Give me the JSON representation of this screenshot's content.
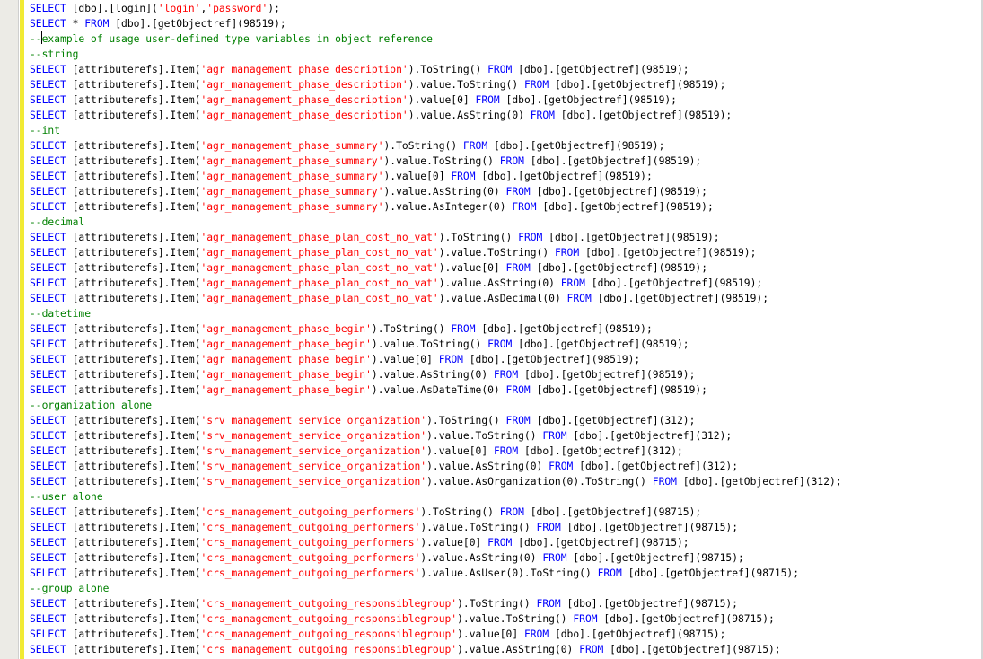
{
  "colors": {
    "keyword": "#0000ff",
    "string": "#ff0000",
    "comment": "#008000",
    "text": "#000000",
    "change_bar": "#f1ea33"
  },
  "lines": [
    [
      [
        "k",
        "SELECT"
      ],
      [
        "t",
        " [dbo].[login]("
      ],
      [
        "s",
        "'login'"
      ],
      [
        "t",
        ","
      ],
      [
        "s",
        "'password'"
      ],
      [
        "t",
        ");"
      ]
    ],
    [
      [
        "k",
        "SELECT"
      ],
      [
        "t",
        " * "
      ],
      [
        "k",
        "FROM"
      ],
      [
        "t",
        " [dbo].[getObjectref](98519);"
      ]
    ],
    [
      [
        "c",
        "--example of usage user-defined type variables in object reference"
      ]
    ],
    [
      [
        "c",
        "--string"
      ]
    ],
    [
      [
        "k",
        "SELECT"
      ],
      [
        "t",
        " [attributerefs].Item("
      ],
      [
        "s",
        "'agr_management_phase_description'"
      ],
      [
        "t",
        ").ToString() "
      ],
      [
        "k",
        "FROM"
      ],
      [
        "t",
        " [dbo].[getObjectref](98519);"
      ]
    ],
    [
      [
        "k",
        "SELECT"
      ],
      [
        "t",
        " [attributerefs].Item("
      ],
      [
        "s",
        "'agr_management_phase_description'"
      ],
      [
        "t",
        ").value.ToString() "
      ],
      [
        "k",
        "FROM"
      ],
      [
        "t",
        " [dbo].[getObjectref](98519);"
      ]
    ],
    [
      [
        "k",
        "SELECT"
      ],
      [
        "t",
        " [attributerefs].Item("
      ],
      [
        "s",
        "'agr_management_phase_description'"
      ],
      [
        "t",
        ").value[0] "
      ],
      [
        "k",
        "FROM"
      ],
      [
        "t",
        " [dbo].[getObjectref](98519);"
      ]
    ],
    [
      [
        "k",
        "SELECT"
      ],
      [
        "t",
        " [attributerefs].Item("
      ],
      [
        "s",
        "'agr_management_phase_description'"
      ],
      [
        "t",
        ").value.AsString(0) "
      ],
      [
        "k",
        "FROM"
      ],
      [
        "t",
        " [dbo].[getObjectref](98519);"
      ]
    ],
    [
      [
        "c",
        "--int"
      ]
    ],
    [
      [
        "k",
        "SELECT"
      ],
      [
        "t",
        " [attributerefs].Item("
      ],
      [
        "s",
        "'agr_management_phase_summary'"
      ],
      [
        "t",
        ").ToString() "
      ],
      [
        "k",
        "FROM"
      ],
      [
        "t",
        " [dbo].[getObjectref](98519);"
      ]
    ],
    [
      [
        "k",
        "SELECT"
      ],
      [
        "t",
        " [attributerefs].Item("
      ],
      [
        "s",
        "'agr_management_phase_summary'"
      ],
      [
        "t",
        ").value.ToString() "
      ],
      [
        "k",
        "FROM"
      ],
      [
        "t",
        " [dbo].[getObjectref](98519);"
      ]
    ],
    [
      [
        "k",
        "SELECT"
      ],
      [
        "t",
        " [attributerefs].Item("
      ],
      [
        "s",
        "'agr_management_phase_summary'"
      ],
      [
        "t",
        ").value[0] "
      ],
      [
        "k",
        "FROM"
      ],
      [
        "t",
        " [dbo].[getObjectref](98519);"
      ]
    ],
    [
      [
        "k",
        "SELECT"
      ],
      [
        "t",
        " [attributerefs].Item("
      ],
      [
        "s",
        "'agr_management_phase_summary'"
      ],
      [
        "t",
        ").value.AsString(0) "
      ],
      [
        "k",
        "FROM"
      ],
      [
        "t",
        " [dbo].[getObjectref](98519);"
      ]
    ],
    [
      [
        "k",
        "SELECT"
      ],
      [
        "t",
        " [attributerefs].Item("
      ],
      [
        "s",
        "'agr_management_phase_summary'"
      ],
      [
        "t",
        ").value.AsInteger(0) "
      ],
      [
        "k",
        "FROM"
      ],
      [
        "t",
        " [dbo].[getObjectref](98519);"
      ]
    ],
    [
      [
        "c",
        "--decimal"
      ]
    ],
    [
      [
        "k",
        "SELECT"
      ],
      [
        "t",
        " [attributerefs].Item("
      ],
      [
        "s",
        "'agr_management_phase_plan_cost_no_vat'"
      ],
      [
        "t",
        ").ToString() "
      ],
      [
        "k",
        "FROM"
      ],
      [
        "t",
        " [dbo].[getObjectref](98519);"
      ]
    ],
    [
      [
        "k",
        "SELECT"
      ],
      [
        "t",
        " [attributerefs].Item("
      ],
      [
        "s",
        "'agr_management_phase_plan_cost_no_vat'"
      ],
      [
        "t",
        ").value.ToString() "
      ],
      [
        "k",
        "FROM"
      ],
      [
        "t",
        " [dbo].[getObjectref](98519);"
      ]
    ],
    [
      [
        "k",
        "SELECT"
      ],
      [
        "t",
        " [attributerefs].Item("
      ],
      [
        "s",
        "'agr_management_phase_plan_cost_no_vat'"
      ],
      [
        "t",
        ").value[0] "
      ],
      [
        "k",
        "FROM"
      ],
      [
        "t",
        " [dbo].[getObjectref](98519);"
      ]
    ],
    [
      [
        "k",
        "SELECT"
      ],
      [
        "t",
        " [attributerefs].Item("
      ],
      [
        "s",
        "'agr_management_phase_plan_cost_no_vat'"
      ],
      [
        "t",
        ").value.AsString(0) "
      ],
      [
        "k",
        "FROM"
      ],
      [
        "t",
        " [dbo].[getObjectref](98519);"
      ]
    ],
    [
      [
        "k",
        "SELECT"
      ],
      [
        "t",
        " [attributerefs].Item("
      ],
      [
        "s",
        "'agr_management_phase_plan_cost_no_vat'"
      ],
      [
        "t",
        ").value.AsDecimal(0) "
      ],
      [
        "k",
        "FROM"
      ],
      [
        "t",
        " [dbo].[getObjectref](98519);"
      ]
    ],
    [
      [
        "c",
        "--datetime"
      ]
    ],
    [
      [
        "k",
        "SELECT"
      ],
      [
        "t",
        " [attributerefs].Item("
      ],
      [
        "s",
        "'agr_management_phase_begin'"
      ],
      [
        "t",
        ").ToString() "
      ],
      [
        "k",
        "FROM"
      ],
      [
        "t",
        " [dbo].[getObjectref](98519);"
      ]
    ],
    [
      [
        "k",
        "SELECT"
      ],
      [
        "t",
        " [attributerefs].Item("
      ],
      [
        "s",
        "'agr_management_phase_begin'"
      ],
      [
        "t",
        ").value.ToString() "
      ],
      [
        "k",
        "FROM"
      ],
      [
        "t",
        " [dbo].[getObjectref](98519);"
      ]
    ],
    [
      [
        "k",
        "SELECT"
      ],
      [
        "t",
        " [attributerefs].Item("
      ],
      [
        "s",
        "'agr_management_phase_begin'"
      ],
      [
        "t",
        ").value[0] "
      ],
      [
        "k",
        "FROM"
      ],
      [
        "t",
        " [dbo].[getObjectref](98519);"
      ]
    ],
    [
      [
        "k",
        "SELECT"
      ],
      [
        "t",
        " [attributerefs].Item("
      ],
      [
        "s",
        "'agr_management_phase_begin'"
      ],
      [
        "t",
        ").value.AsString(0) "
      ],
      [
        "k",
        "FROM"
      ],
      [
        "t",
        " [dbo].[getObjectref](98519);"
      ]
    ],
    [
      [
        "k",
        "SELECT"
      ],
      [
        "t",
        " [attributerefs].Item("
      ],
      [
        "s",
        "'agr_management_phase_begin'"
      ],
      [
        "t",
        ").value.AsDateTime(0) "
      ],
      [
        "k",
        "FROM"
      ],
      [
        "t",
        " [dbo].[getObjectref](98519);"
      ]
    ],
    [
      [
        "c",
        "--organization alone"
      ]
    ],
    [
      [
        "k",
        "SELECT"
      ],
      [
        "t",
        " [attributerefs].Item("
      ],
      [
        "s",
        "'srv_management_service_organization'"
      ],
      [
        "t",
        ").ToString() "
      ],
      [
        "k",
        "FROM"
      ],
      [
        "t",
        " [dbo].[getObjectref](312);"
      ]
    ],
    [
      [
        "k",
        "SELECT"
      ],
      [
        "t",
        " [attributerefs].Item("
      ],
      [
        "s",
        "'srv_management_service_organization'"
      ],
      [
        "t",
        ").value.ToString() "
      ],
      [
        "k",
        "FROM"
      ],
      [
        "t",
        " [dbo].[getObjectref](312);"
      ]
    ],
    [
      [
        "k",
        "SELECT"
      ],
      [
        "t",
        " [attributerefs].Item("
      ],
      [
        "s",
        "'srv_management_service_organization'"
      ],
      [
        "t",
        ").value[0] "
      ],
      [
        "k",
        "FROM"
      ],
      [
        "t",
        " [dbo].[getObjectref](312);"
      ]
    ],
    [
      [
        "k",
        "SELECT"
      ],
      [
        "t",
        " [attributerefs].Item("
      ],
      [
        "s",
        "'srv_management_service_organization'"
      ],
      [
        "t",
        ").value.AsString(0) "
      ],
      [
        "k",
        "FROM"
      ],
      [
        "t",
        " [dbo].[getObjectref](312);"
      ]
    ],
    [
      [
        "k",
        "SELECT"
      ],
      [
        "t",
        " [attributerefs].Item("
      ],
      [
        "s",
        "'srv_management_service_organization'"
      ],
      [
        "t",
        ").value.AsOrganization(0).ToString() "
      ],
      [
        "k",
        "FROM"
      ],
      [
        "t",
        " [dbo].[getObjectref](312);"
      ]
    ],
    [
      [
        "c",
        "--user alone"
      ]
    ],
    [
      [
        "k",
        "SELECT"
      ],
      [
        "t",
        " [attributerefs].Item("
      ],
      [
        "s",
        "'crs_management_outgoing_performers'"
      ],
      [
        "t",
        ").ToString() "
      ],
      [
        "k",
        "FROM"
      ],
      [
        "t",
        " [dbo].[getObjectref](98715);"
      ]
    ],
    [
      [
        "k",
        "SELECT"
      ],
      [
        "t",
        " [attributerefs].Item("
      ],
      [
        "s",
        "'crs_management_outgoing_performers'"
      ],
      [
        "t",
        ").value.ToString() "
      ],
      [
        "k",
        "FROM"
      ],
      [
        "t",
        " [dbo].[getObjectref](98715);"
      ]
    ],
    [
      [
        "k",
        "SELECT"
      ],
      [
        "t",
        " [attributerefs].Item("
      ],
      [
        "s",
        "'crs_management_outgoing_performers'"
      ],
      [
        "t",
        ").value[0] "
      ],
      [
        "k",
        "FROM"
      ],
      [
        "t",
        " [dbo].[getObjectref](98715);"
      ]
    ],
    [
      [
        "k",
        "SELECT"
      ],
      [
        "t",
        " [attributerefs].Item("
      ],
      [
        "s",
        "'crs_management_outgoing_performers'"
      ],
      [
        "t",
        ").value.AsString(0) "
      ],
      [
        "k",
        "FROM"
      ],
      [
        "t",
        " [dbo].[getObjectref](98715);"
      ]
    ],
    [
      [
        "k",
        "SELECT"
      ],
      [
        "t",
        " [attributerefs].Item("
      ],
      [
        "s",
        "'crs_management_outgoing_performers'"
      ],
      [
        "t",
        ").value.AsUser(0).ToString() "
      ],
      [
        "k",
        "FROM"
      ],
      [
        "t",
        " [dbo].[getObjectref](98715);"
      ]
    ],
    [
      [
        "c",
        "--group alone"
      ]
    ],
    [
      [
        "k",
        "SELECT"
      ],
      [
        "t",
        " [attributerefs].Item("
      ],
      [
        "s",
        "'crs_management_outgoing_responsiblegroup'"
      ],
      [
        "t",
        ").ToString() "
      ],
      [
        "k",
        "FROM"
      ],
      [
        "t",
        " [dbo].[getObjectref](98715);"
      ]
    ],
    [
      [
        "k",
        "SELECT"
      ],
      [
        "t",
        " [attributerefs].Item("
      ],
      [
        "s",
        "'crs_management_outgoing_responsiblegroup'"
      ],
      [
        "t",
        ").value.ToString() "
      ],
      [
        "k",
        "FROM"
      ],
      [
        "t",
        " [dbo].[getObjectref](98715);"
      ]
    ],
    [
      [
        "k",
        "SELECT"
      ],
      [
        "t",
        " [attributerefs].Item("
      ],
      [
        "s",
        "'crs_management_outgoing_responsiblegroup'"
      ],
      [
        "t",
        ").value[0] "
      ],
      [
        "k",
        "FROM"
      ],
      [
        "t",
        " [dbo].[getObjectref](98715);"
      ]
    ],
    [
      [
        "k",
        "SELECT"
      ],
      [
        "t",
        " [attributerefs].Item("
      ],
      [
        "s",
        "'crs_management_outgoing_responsiblegroup'"
      ],
      [
        "t",
        ").value.AsString(0) "
      ],
      [
        "k",
        "FROM"
      ],
      [
        "t",
        " [dbo].[getObjectref](98715);"
      ]
    ]
  ]
}
